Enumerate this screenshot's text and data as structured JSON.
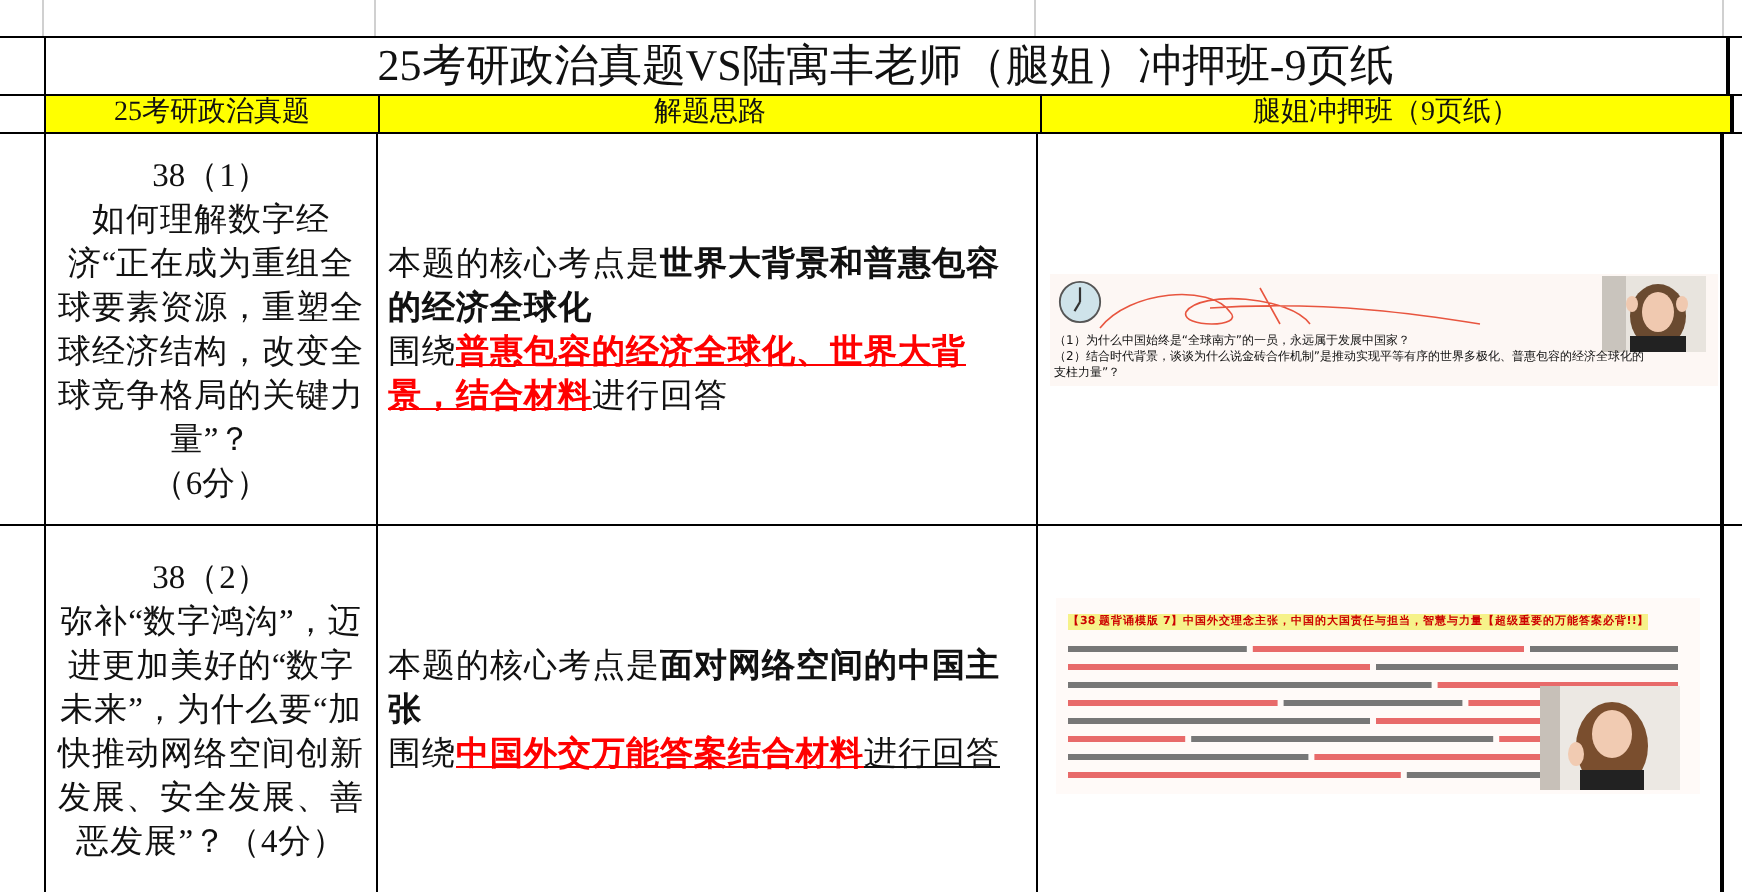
{
  "title": "25考研政治真题VS陆寓丰老师（腿姐）冲押班-9页纸",
  "columns": [
    "25考研政治真题",
    "解题思路",
    "腿姐冲押班（9页纸）"
  ],
  "rows": [
    {
      "question_number": "38（1）",
      "question": "如何理解数字经济“正在成为重组全球要素资源，重塑全球经济结构，改变全球竞争格局的关键力量”？",
      "score": "（6分）",
      "analysis": "本题的核心考点是**世界大背景和普惠包容的经济全球化**",
      "approach": [
        {
          "text": "围绕",
          "kind": "plain"
        },
        {
          "text": "普惠包容的经济全球化、世界大背景，结合材料",
          "kind": "keyphrase"
        },
        {
          "text": "进行回答",
          "kind": "plain"
        }
      ],
      "material": {
        "kind": "slide",
        "lines": [
          "（1）为什么中国始终是“全球南方”的一员，永远属于发展中国家？",
          "（2）结合时代背景，谈谈为什么说金砖合作机制”是推动实现平等有序的世界多极化、普惠包容的经济全球化的支柱力量”？"
        ]
      }
    },
    {
      "question_number": "38（2）",
      "question": "弥补“数字鸿沟”，迈进更加美好的“数字未来”，为什么要“加快推动网络空间创新发展、安全发展、善恶发展”？（4分）",
      "analysis": "本题的核心考点是**面对网络空间的中国主张**",
      "approach": [
        {
          "text": "围绕",
          "kind": "plain"
        },
        {
          "text": "中国外交万能答案结合材料",
          "kind": "keyphrase"
        },
        {
          "text": "进行回答",
          "kind": "underlined"
        }
      ],
      "material": {
        "kind": "document",
        "heading": "【38 题背诵模版 7】中国外交理念主张，中国的大国责任与担当，智慧与力量【超级重要的万能答案必背!!】"
      }
    }
  ]
}
